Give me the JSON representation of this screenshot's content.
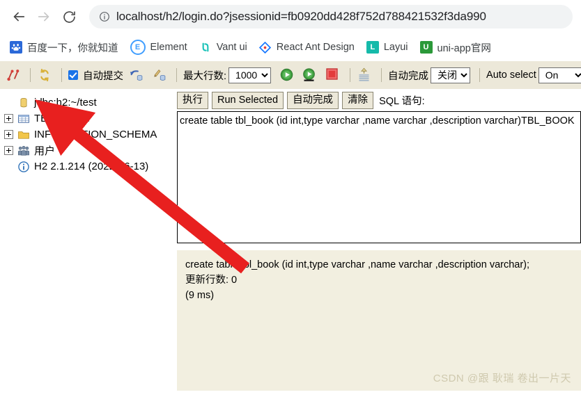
{
  "browser": {
    "back_icon": "back-arrow-icon",
    "forward_icon": "forward-arrow-icon",
    "reload_icon": "reload-icon",
    "site_info_icon": "info-circle-icon",
    "url": "localhost/h2/login.do?jsessionid=fb0920dd428f752d788421532f3da990"
  },
  "bookmarks": [
    {
      "label": "百度一下，你就知道",
      "icon": "baidu-paw-icon",
      "color": "#2b69d8",
      "glyph": "熊"
    },
    {
      "label": "Element",
      "icon": "element-ui-icon",
      "color": "#409eff",
      "glyph": "E"
    },
    {
      "label": "Vant ui",
      "icon": "vant-ui-icon",
      "color": "#07c160",
      "glyph": "V"
    },
    {
      "label": "React Ant Design",
      "icon": "ant-design-icon",
      "color": "#1677ff",
      "glyph": "◆"
    },
    {
      "label": "Layui",
      "icon": "layui-icon",
      "color": "#16baaa",
      "glyph": "L"
    },
    {
      "label": "uni-app官网",
      "icon": "uniapp-icon",
      "color": "#2b9939",
      "glyph": "U"
    }
  ],
  "toolbar": {
    "disconnect_icon": "disconnect-icon",
    "refresh_icon": "refresh-icon",
    "autocommit_label": "自动提交",
    "rollback_icon": "rollback-icon",
    "commit_icon": "commit-icon",
    "maxrows_label": "最大行数:",
    "maxrows_value": "1000",
    "run_icon": "run-icon",
    "run_selected_icon": "run-selected-icon",
    "stop_icon": "stop-icon",
    "clear_output_icon": "clear-output-icon",
    "autocomplete_label": "自动完成",
    "autocomplete_value": "关闭",
    "autoselect_label": "Auto select",
    "autoselect_value": "On"
  },
  "tree": [
    {
      "label": "jdbc:h2:~/test",
      "icon": "database-icon",
      "expandable": false
    },
    {
      "label": "TBL_BOOK",
      "icon": "table-icon",
      "expandable": true
    },
    {
      "label": "INFORMATION_SCHEMA",
      "icon": "folder-icon",
      "expandable": true
    },
    {
      "label": "用户",
      "icon": "users-icon",
      "expandable": true
    },
    {
      "label": "H2 2.1.214 (2022-06-13)",
      "icon": "info-icon",
      "expandable": false
    }
  ],
  "sql_panel": {
    "buttons": [
      {
        "label": "执行",
        "name": "run-button"
      },
      {
        "label": "Run Selected",
        "name": "run-selected-button"
      },
      {
        "label": "自动完成",
        "name": "autocomplete-button"
      },
      {
        "label": "清除",
        "name": "clear-button"
      }
    ],
    "statement_label": "SQL 语句:",
    "editor_value": "create table tbl_book (id int,type varchar ,name varchar ,description varchar)TBL_BOOK"
  },
  "result": {
    "lines": [
      "create table tbl_book (id int,type varchar ,name varchar ,description varchar);",
      "更新行数: 0",
      "(9 ms)"
    ]
  },
  "watermark": "CSDN @跟 耿瑞 卷出一片天",
  "annotation": {
    "arrow_color": "#e8201f",
    "arrow_name": "red-pointer-arrow"
  }
}
